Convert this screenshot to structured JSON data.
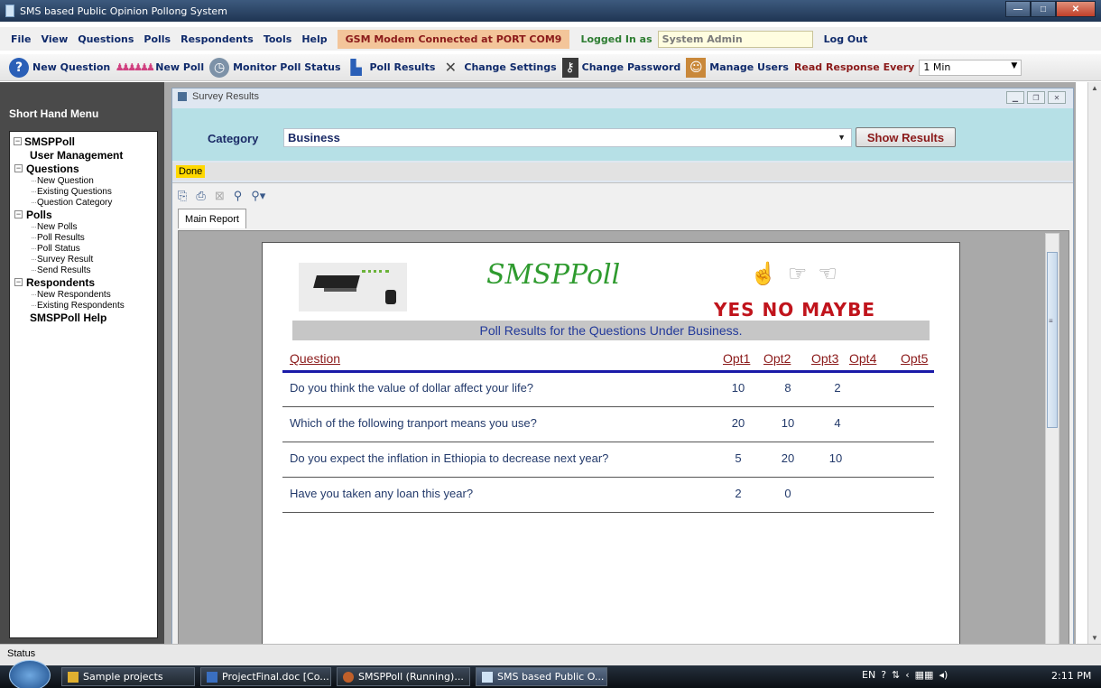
{
  "window": {
    "title": "SMS based Public Opinion Pollong System"
  },
  "menu": {
    "items": [
      "File",
      "View",
      "Questions",
      "Polls",
      "Respondents",
      "Tools",
      "Help"
    ],
    "gsm_status": "GSM Modem Connected at PORT COM9",
    "logged_in_label": "Logged In as",
    "user": "System Admin",
    "logout": "Log Out"
  },
  "toolbar": {
    "new_question": "New Question",
    "new_poll": "New Poll",
    "monitor_poll": "Monitor Poll Status",
    "poll_results": "Poll Results",
    "change_settings": "Change Settings",
    "change_password": "Change Password",
    "manage_users": "Manage Users",
    "read_response_label": "Read Response Every",
    "read_response_value": "1 Min"
  },
  "sidebar": {
    "heading": "Short Hand Menu",
    "root": "SMSPPoll",
    "user_management": "User Management",
    "questions": {
      "label": "Questions",
      "items": [
        "New Question",
        "Existing Questions",
        "Question Category"
      ]
    },
    "polls": {
      "label": "Polls",
      "items": [
        "New Polls",
        "Poll Results",
        "Poll Status",
        "Survey Result",
        "Send Results"
      ]
    },
    "respondents": {
      "label": "Respondents",
      "items": [
        "New Respondents",
        "Existing Respondents"
      ]
    },
    "help": "SMSPPoll Help"
  },
  "child_window": {
    "title": "Survey Results",
    "category_label": "Category",
    "category_value": "Business",
    "show_button": "Show Results",
    "status": "Done",
    "tab": "Main Report"
  },
  "report": {
    "brand": "SMSPPoll",
    "tagline": "YES NO MAYBE",
    "band_title": "Poll Results for the Questions Under Business.",
    "headers": {
      "question": "Question",
      "opt1": "Opt1",
      "opt2": "Opt2",
      "opt3": "Opt3",
      "opt4": "Opt4",
      "opt5": "Opt5"
    },
    "rows": [
      {
        "question": "Do you think the value of dollar affect your life?",
        "opt1": "10",
        "opt2": "8",
        "opt3": "2"
      },
      {
        "question": "Which of the following tranport means you use?",
        "opt1": "20",
        "opt2": "10",
        "opt3": "4"
      },
      {
        "question": "Do you expect  the inflation in Ethiopia to decrease  next year?",
        "opt1": "5",
        "opt2": "20",
        "opt3": "10"
      },
      {
        "question": "Have you taken any loan this year?",
        "opt1": "2",
        "opt2": "0",
        "opt3": ""
      }
    ]
  },
  "statusbar": {
    "text": "Status"
  },
  "taskbar": {
    "buttons": [
      "Sample projects",
      "ProjectFinal.doc [Co...",
      "SMSPPoll (Running)...",
      "SMS based Public O..."
    ],
    "lang": "EN",
    "time": "2:11 PM"
  },
  "colors": {
    "accent": "#0f2a6b",
    "category_panel": "#b6e0e6",
    "gsm_badge": "#f3c59a",
    "header_red": "#8b1a1a",
    "brand_green": "#2f9b2f"
  }
}
